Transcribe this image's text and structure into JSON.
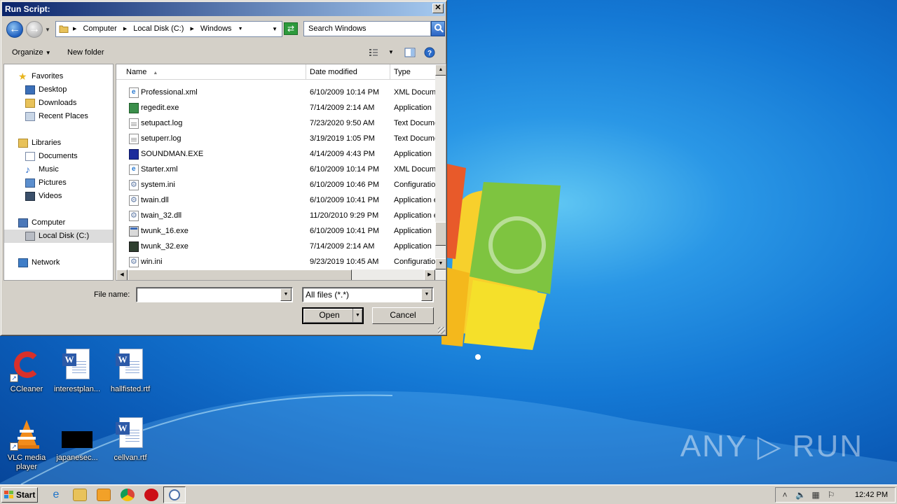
{
  "dialog": {
    "title": "Run Script:",
    "close_label": "✕",
    "breadcrumb": [
      "Computer",
      "Local Disk (C:)",
      "Windows"
    ],
    "search_placeholder": "Search Windows",
    "toolbar": {
      "organize": "Organize",
      "new_folder": "New folder"
    },
    "nav": {
      "favorites": "Favorites",
      "desktop": "Desktop",
      "downloads": "Downloads",
      "recent": "Recent Places",
      "libraries": "Libraries",
      "documents": "Documents",
      "music": "Music",
      "pictures": "Pictures",
      "videos": "Videos",
      "computer": "Computer",
      "local_disk": "Local Disk (C:)",
      "network": "Network"
    },
    "columns": {
      "name": "Name",
      "date": "Date modified",
      "type": "Type"
    },
    "files": [
      {
        "name": "Professional.xml",
        "date": "6/10/2009 10:14 PM",
        "type": "XML Document",
        "icon": "xml-file-icon"
      },
      {
        "name": "regedit.exe",
        "date": "7/14/2009 2:14 AM",
        "type": "Application",
        "icon": "regedit-icon"
      },
      {
        "name": "setupact.log",
        "date": "7/23/2020 9:50 AM",
        "type": "Text Document",
        "icon": "text-file-icon"
      },
      {
        "name": "setuperr.log",
        "date": "3/19/2019 1:05 PM",
        "type": "Text Document",
        "icon": "text-file-icon"
      },
      {
        "name": "SOUNDMAN.EXE",
        "date": "4/14/2009 4:43 PM",
        "type": "Application",
        "icon": "soundman-icon"
      },
      {
        "name": "Starter.xml",
        "date": "6/10/2009 10:14 PM",
        "type": "XML Document",
        "icon": "xml-file-icon"
      },
      {
        "name": "system.ini",
        "date": "6/10/2009 10:46 PM",
        "type": "Configuration",
        "icon": "config-file-icon"
      },
      {
        "name": "twain.dll",
        "date": "6/10/2009 10:41 PM",
        "type": "Application extension",
        "icon": "dll-file-icon"
      },
      {
        "name": "twain_32.dll",
        "date": "11/20/2010 9:29 PM",
        "type": "Application extension",
        "icon": "dll-file-icon"
      },
      {
        "name": "twunk_16.exe",
        "date": "6/10/2009 10:41 PM",
        "type": "Application",
        "icon": "app-window-icon"
      },
      {
        "name": "twunk_32.exe",
        "date": "7/14/2009 2:14 AM",
        "type": "Application",
        "icon": "twunk-icon"
      },
      {
        "name": "win.ini",
        "date": "9/23/2019 10:45 AM",
        "type": "Configuration",
        "icon": "config-file-icon"
      }
    ],
    "file_name_label": "File name:",
    "file_name_value": "",
    "file_type": "All files (*.*)",
    "open_label": "Open",
    "cancel_label": "Cancel"
  },
  "desktop": {
    "icons": [
      {
        "label": "CCleaner"
      },
      {
        "label": "interestplan..."
      },
      {
        "label": "hallfisted.rtf"
      },
      {
        "label": "VLC media player"
      },
      {
        "label": "japanesec..."
      },
      {
        "label": "cellvan.rtf"
      }
    ],
    "watermark": "ANY ▷ RUN"
  },
  "taskbar": {
    "start_label": "Start",
    "clock": "12:42 PM"
  }
}
